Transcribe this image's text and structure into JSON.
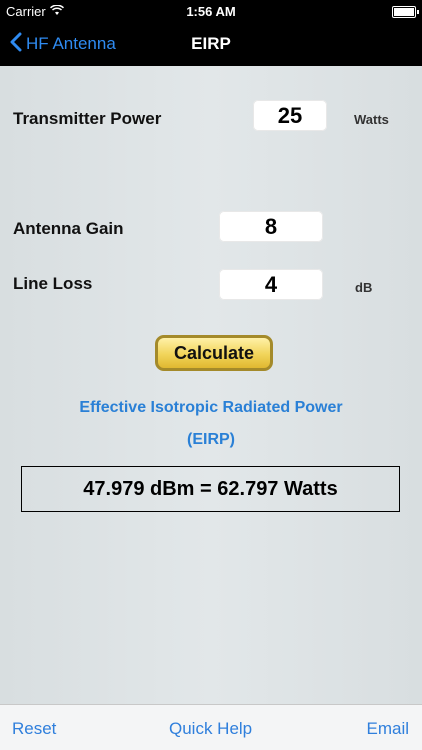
{
  "status_bar": {
    "carrier": "Carrier",
    "time": "1:56 AM",
    "wifi_icon": "wifi-icon",
    "battery_icon": "battery-icon"
  },
  "nav": {
    "back_label": "HF Antenna",
    "back_icon": "chevron-left-icon",
    "title": "EIRP"
  },
  "form": {
    "transmitter_power": {
      "label": "Transmitter Power",
      "value": "25",
      "unit": "Watts"
    },
    "antenna_gain": {
      "label": "Antenna Gain",
      "value": "8"
    },
    "line_loss": {
      "label": "Line Loss",
      "value": "4",
      "unit": "dB"
    }
  },
  "calculate_label": "Calculate",
  "result": {
    "title_line1": "Effective Isotropic Radiated Power",
    "title_line2": "(EIRP)",
    "value": "47.979 dBm = 62.797 Watts"
  },
  "toolbar": {
    "reset": "Reset",
    "quick_help": "Quick Help",
    "email": "Email"
  },
  "colors": {
    "accent": "#2f8bf1",
    "result_title": "#2a80d6",
    "button_gold": "#f1d45a",
    "background": "#dfe4e6"
  }
}
